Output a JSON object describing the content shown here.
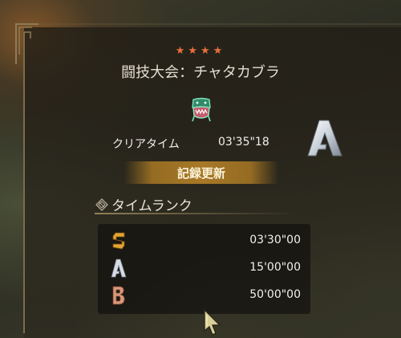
{
  "quest": {
    "stars": "★★★★",
    "title": "闘技大会：チャタカブラ",
    "monster_icon": "chatacabra-icon"
  },
  "result": {
    "clear_label": "クリアタイム",
    "clear_time": "03'35\"18",
    "rank": "A",
    "record_label": "記録更新"
  },
  "time_rank": {
    "title": "タイムランク",
    "rows": [
      {
        "rank": "S",
        "time": "03'30\"00"
      },
      {
        "rank": "A",
        "time": "15'00\"00"
      },
      {
        "rank": "B",
        "time": "50'00\"00"
      }
    ]
  },
  "colors": {
    "star": "#e8703a",
    "rank_s": "#e3a532",
    "rank_a": "#d7dde4",
    "rank_b": "#d9987a",
    "banner": "#a8772a"
  }
}
